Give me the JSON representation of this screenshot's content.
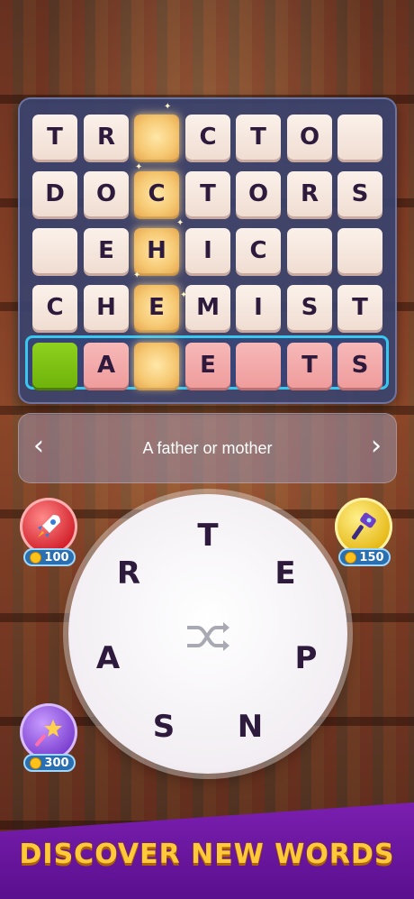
{
  "grid": {
    "rows": [
      {
        "cells": [
          {
            "letter": "T",
            "style": "plain"
          },
          {
            "letter": "R",
            "style": "plain"
          },
          {
            "letter": "",
            "style": "gold"
          },
          {
            "letter": "C",
            "style": "plain"
          },
          {
            "letter": "T",
            "style": "plain"
          },
          {
            "letter": "O",
            "style": "plain"
          },
          {
            "letter": "",
            "style": "plain"
          }
        ]
      },
      {
        "cells": [
          {
            "letter": "D",
            "style": "plain"
          },
          {
            "letter": "O",
            "style": "plain"
          },
          {
            "letter": "C",
            "style": "gold"
          },
          {
            "letter": "T",
            "style": "plain"
          },
          {
            "letter": "O",
            "style": "plain"
          },
          {
            "letter": "R",
            "style": "plain"
          },
          {
            "letter": "S",
            "style": "plain"
          }
        ]
      },
      {
        "cells": [
          {
            "letter": "",
            "style": "plain"
          },
          {
            "letter": "E",
            "style": "plain"
          },
          {
            "letter": "H",
            "style": "gold"
          },
          {
            "letter": "I",
            "style": "plain"
          },
          {
            "letter": "C",
            "style": "plain"
          },
          {
            "letter": "",
            "style": "plain"
          },
          {
            "letter": "",
            "style": "plain"
          }
        ]
      },
      {
        "cells": [
          {
            "letter": "C",
            "style": "plain"
          },
          {
            "letter": "H",
            "style": "plain"
          },
          {
            "letter": "E",
            "style": "gold"
          },
          {
            "letter": "M",
            "style": "plain"
          },
          {
            "letter": "I",
            "style": "plain"
          },
          {
            "letter": "S",
            "style": "plain"
          },
          {
            "letter": "T",
            "style": "plain"
          }
        ]
      },
      {
        "cells": [
          {
            "letter": "",
            "style": "green"
          },
          {
            "letter": "A",
            "style": "pink"
          },
          {
            "letter": "",
            "style": "gold"
          },
          {
            "letter": "E",
            "style": "pink"
          },
          {
            "letter": "",
            "style": "pink"
          },
          {
            "letter": "T",
            "style": "pink"
          },
          {
            "letter": "S",
            "style": "pink"
          }
        ]
      }
    ]
  },
  "clue": {
    "text": "A father or mother",
    "prev_icon": "chevron-left-icon",
    "next_icon": "chevron-right-icon"
  },
  "wheel": {
    "letters": [
      "T",
      "E",
      "P",
      "N",
      "S",
      "A",
      "R"
    ],
    "shuffle_icon": "shuffle-icon"
  },
  "boosters": [
    {
      "name": "rocket",
      "icon": "rocket-icon",
      "price": "100",
      "color": "#e23a3a"
    },
    {
      "name": "hammer",
      "icon": "hammer-icon",
      "price": "150",
      "color": "#f0c020"
    },
    {
      "name": "magic-wand",
      "icon": "magic-wand-icon",
      "price": "300",
      "color": "#8a4fd8"
    }
  ],
  "banner": {
    "text": "DISCOVER NEW WORDS"
  },
  "colors": {
    "accent": "#38c7ef",
    "gold": "#f6c872",
    "banner": "#6a16a0",
    "banner_text": "#ffc93a"
  }
}
